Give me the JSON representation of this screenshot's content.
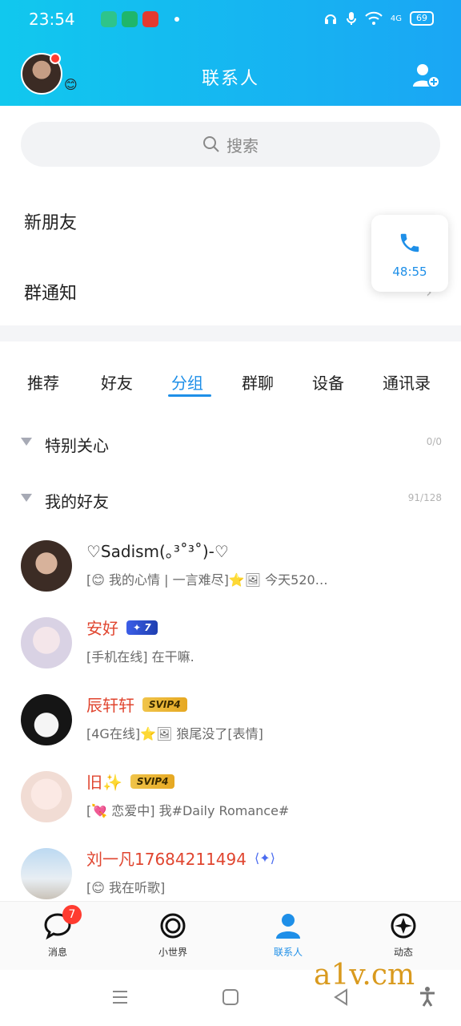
{
  "status_bar": {
    "time": "23:54",
    "network": "4G",
    "battery": "69"
  },
  "header": {
    "title": "联系人",
    "emoji": "😊"
  },
  "search": {
    "placeholder": "搜索"
  },
  "links": [
    {
      "label": "新朋友"
    },
    {
      "label": "群通知"
    }
  ],
  "call_card": {
    "duration": "48:55"
  },
  "tabs": [
    {
      "label": "推荐"
    },
    {
      "label": "好友"
    },
    {
      "label": "分组",
      "active": true
    },
    {
      "label": "群聊"
    },
    {
      "label": "设备"
    },
    {
      "label": "通讯录"
    }
  ],
  "groups": [
    {
      "name": "特别关心",
      "count": "0/0"
    },
    {
      "name": "我的好友",
      "count": "91/128"
    }
  ],
  "contacts": [
    {
      "name": "♡Sadism(｡³˚³˚)-♡",
      "status": "[😊 我的心情 | 一言难尽]⭐🖼 今天520…",
      "badge": ""
    },
    {
      "name": "安好",
      "status": "[手机在线] 在干嘛.",
      "badge": "7"
    },
    {
      "name": "辰轩轩",
      "status": "[4G在线]⭐🖼 狼尾没了[表情]",
      "badge": "SVIP4"
    },
    {
      "name": "旧✨",
      "status": "[💘 恋爱中] 我#Daily Romance#",
      "badge": "SVIP4"
    },
    {
      "name": "刘一凡17684211494",
      "status": "[😊 我在听歌]",
      "badge": ""
    }
  ],
  "bottom_nav": {
    "messages": "消息",
    "messages_badge": "7",
    "world": "小世界",
    "contacts": "联系人",
    "moments": "动态"
  },
  "watermark": "a1v.cm"
}
